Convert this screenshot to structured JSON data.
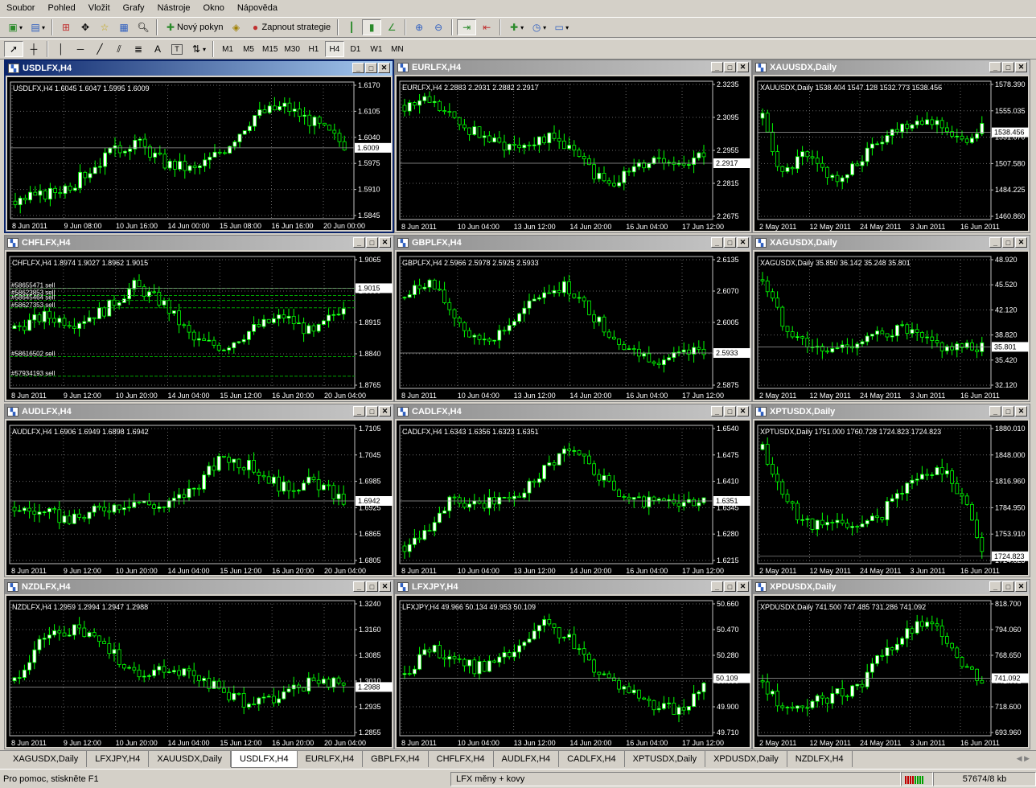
{
  "menu": [
    "Soubor",
    "Pohled",
    "Vložit",
    "Grafy",
    "Nástroje",
    "Okno",
    "Nápověda"
  ],
  "toolbar": {
    "new_order": "Nový pokyn",
    "start_strategy": "Zapnout strategie",
    "text_tool": "A",
    "label_tool": "T",
    "timeframes": [
      "M1",
      "M5",
      "M15",
      "M30",
      "H1",
      "H4",
      "D1",
      "W1",
      "MN"
    ],
    "active_timeframe": "H4"
  },
  "colors": {
    "chart_bg": "#000000",
    "bull": "#ffffff",
    "bear": "#00ff00",
    "grid": "#646464",
    "order_line": "#00a000",
    "active_title": "#0a246a",
    "inactive_title": "#8e8e8e"
  },
  "charts": [
    {
      "title": "USDLFX,H4",
      "info": "USDLFX,H4  1.6045 1.6047 1.5995 1.6009",
      "current": "1.6009",
      "prices": [
        "1.6170",
        "1.6105",
        "1.6040",
        "1.5975",
        "1.5910",
        "1.5845"
      ],
      "dates": [
        "8 Jun 2011",
        "9 Jun 08:00",
        "10 Jun 16:00",
        "14 Jun 00:00",
        "15 Jun 08:00",
        "16 Jun 16:00",
        "20 Jun 00:00"
      ],
      "trend": [
        0.1,
        0.15,
        0.25,
        0.45,
        0.58,
        0.4,
        0.35,
        0.52,
        0.78,
        0.85,
        0.72,
        0.55
      ],
      "cur_frac": 0.52,
      "active": true
    },
    {
      "title": "EURLFX,H4",
      "info": "EURLFX,H4  2.2883 2.2931 2.2882 2.2917",
      "current": "2.2917",
      "prices": [
        "2.3235",
        "2.3095",
        "2.2955",
        "2.2815",
        "2.2675"
      ],
      "dates": [
        "8 Jun 2011",
        "10 Jun 04:00",
        "13 Jun 12:00",
        "14 Jun 20:00",
        "16 Jun 04:00",
        "17 Jun 12:00"
      ],
      "trend": [
        0.85,
        0.9,
        0.75,
        0.65,
        0.55,
        0.55,
        0.6,
        0.55,
        0.35,
        0.25,
        0.35,
        0.45,
        0.4,
        0.48
      ],
      "cur_frac": 0.4,
      "active": false
    },
    {
      "title": "XAUUSDX,Daily",
      "info": "XAUUSDX,Daily  1538.404 1547.128 1532.773 1538.456",
      "current": "1538.456",
      "prices": [
        "1578.390",
        "1555.035",
        "1531.670",
        "1507.580",
        "1484.225",
        "1460.860"
      ],
      "dates": [
        "2 May 2011",
        "12 May 2011",
        "24 May 2011",
        "3 Jun 2011",
        "16 Jun 2011"
      ],
      "trend": [
        0.75,
        0.3,
        0.45,
        0.35,
        0.25,
        0.45,
        0.6,
        0.7,
        0.75,
        0.7,
        0.55,
        0.7
      ],
      "cur_frac": 0.64,
      "active": false
    },
    {
      "title": "CHFLFX,H4",
      "info": "CHFLFX,H4  1.8974 1.9027 1.8962 1.9015",
      "current": "1.9015",
      "prices": [
        "1.9065",
        "1.8990",
        "1.8915",
        "1.8840",
        "1.8765"
      ],
      "dates": [
        "8 Jun 2011",
        "9 Jun 12:00",
        "10 Jun 20:00",
        "14 Jun 04:00",
        "15 Jun 12:00",
        "16 Jun 20:00",
        "20 Jun 04:00"
      ],
      "trend": [
        0.45,
        0.55,
        0.5,
        0.6,
        0.8,
        0.65,
        0.35,
        0.3,
        0.45,
        0.55,
        0.4,
        0.65
      ],
      "cur_frac": 0.78,
      "active": false,
      "orders": [
        "#58655471 sell",
        "#58623853 sell",
        "#58645464 sell",
        "#58627353 sell",
        "#58616502 sell",
        "#57934193 sell"
      ]
    },
    {
      "title": "GBPLFX,H4",
      "info": "GBPLFX,H4  2.5966 2.5978 2.5925 2.5933",
      "current": "2.5933",
      "prices": [
        "2.6135",
        "2.6070",
        "2.6005",
        "2.5940",
        "2.5875"
      ],
      "dates": [
        "8 Jun 2011",
        "10 Jun 04:00",
        "13 Jun 12:00",
        "14 Jun 20:00",
        "16 Jun 04:00",
        "17 Jun 12:00"
      ],
      "trend": [
        0.7,
        0.85,
        0.6,
        0.35,
        0.4,
        0.55,
        0.75,
        0.8,
        0.6,
        0.4,
        0.25,
        0.2,
        0.22,
        0.28
      ],
      "cur_frac": 0.25,
      "active": false
    },
    {
      "title": "XAGUSDX,Daily",
      "info": "XAGUSDX,Daily  35.850 36.142 35.248 35.801",
      "current": "35.801",
      "prices": [
        "48.920",
        "45.520",
        "42.120",
        "38.820",
        "35.420",
        "32.120"
      ],
      "dates": [
        "2 May 2011",
        "12 May 2011",
        "24 May 2011",
        "3 Jun 2011",
        "16 Jun 2011"
      ],
      "trend": [
        0.85,
        0.5,
        0.35,
        0.25,
        0.3,
        0.35,
        0.4,
        0.45,
        0.35,
        0.3,
        0.28,
        0.3
      ],
      "cur_frac": 0.3,
      "active": false
    },
    {
      "title": "AUDLFX,H4",
      "info": "AUDLFX,H4  1.6906 1.6949 1.6898 1.6942",
      "current": "1.6942",
      "prices": [
        "1.7105",
        "1.7045",
        "1.6985",
        "1.6925",
        "1.6865",
        "1.6805"
      ],
      "dates": [
        "8 Jun 2011",
        "9 Jun 12:00",
        "10 Jun 20:00",
        "14 Jun 04:00",
        "15 Jun 12:00",
        "16 Jun 20:00",
        "20 Jun 04:00"
      ],
      "trend": [
        0.4,
        0.35,
        0.3,
        0.4,
        0.45,
        0.4,
        0.55,
        0.8,
        0.7,
        0.55,
        0.6,
        0.45
      ],
      "cur_frac": 0.45,
      "active": false
    },
    {
      "title": "CADLFX,H4",
      "info": "CADLFX,H4  1.6343 1.6356 1.6323 1.6351",
      "current": "1.6351",
      "prices": [
        "1.6540",
        "1.6475",
        "1.6410",
        "1.6345",
        "1.6280",
        "1.6215"
      ],
      "dates": [
        "8 Jun 2011",
        "10 Jun 04:00",
        "13 Jun 12:00",
        "14 Jun 20:00",
        "16 Jun 04:00",
        "17 Jun 12:00"
      ],
      "trend": [
        0.1,
        0.25,
        0.45,
        0.4,
        0.45,
        0.5,
        0.7,
        0.85,
        0.75,
        0.55,
        0.45,
        0.45,
        0.42,
        0.43
      ],
      "cur_frac": 0.45,
      "active": false
    },
    {
      "title": "XPTUSDX,Daily",
      "info": "XPTUSDX,Daily  1751.000 1760.728 1724.823 1724.823",
      "current": "1724.823",
      "prices": [
        "1880.010",
        "1848.000",
        "1816.960",
        "1784.950",
        "1753.910",
        "1724.823"
      ],
      "dates": [
        "2 May 2011",
        "12 May 2011",
        "24 May 2011",
        "3 Jun 2011",
        "16 Jun 2011"
      ],
      "trend": [
        0.85,
        0.5,
        0.3,
        0.25,
        0.28,
        0.25,
        0.35,
        0.55,
        0.65,
        0.7,
        0.5,
        0.1
      ],
      "cur_frac": 0.02,
      "active": false
    },
    {
      "title": "NZDLFX,H4",
      "info": "NZDLFX,H4  1.2959 1.2994 1.2947 1.2988",
      "current": "1.2988",
      "prices": [
        "1.3240",
        "1.3160",
        "1.3085",
        "1.3010",
        "1.2935",
        "1.2855"
      ],
      "dates": [
        "8 Jun 2011",
        "9 Jun 12:00",
        "10 Jun 20:00",
        "14 Jun 04:00",
        "15 Jun 12:00",
        "16 Jun 20:00",
        "20 Jun 04:00"
      ],
      "trend": [
        0.4,
        0.75,
        0.8,
        0.7,
        0.45,
        0.5,
        0.45,
        0.3,
        0.2,
        0.3,
        0.4,
        0.38
      ],
      "cur_frac": 0.35,
      "active": false
    },
    {
      "title": "LFXJPY,H4",
      "info": "LFXJPY,H4  49.966 50.134 49.953 50.109",
      "current": "50.109",
      "prices": [
        "50.660",
        "50.470",
        "50.280",
        "50.090",
        "49.900",
        "49.710"
      ],
      "dates": [
        "8 Jun 2011",
        "10 Jun 04:00",
        "13 Jun 12:00",
        "14 Jun 20:00",
        "16 Jun 04:00",
        "17 Jun 12:00"
      ],
      "trend": [
        0.45,
        0.65,
        0.6,
        0.5,
        0.55,
        0.65,
        0.85,
        0.75,
        0.55,
        0.4,
        0.3,
        0.2,
        0.15,
        0.35
      ],
      "cur_frac": 0.42,
      "active": false
    },
    {
      "title": "XPDUSDX,Daily",
      "info": "XPDUSDX,Daily  741.500 747.485 731.286 741.092",
      "current": "741.092",
      "prices": [
        "818.700",
        "794.060",
        "768.650",
        "741.092",
        "718.600",
        "693.960"
      ],
      "dates": [
        "2 May 2011",
        "12 May 2011",
        "24 May 2011",
        "3 Jun 2011",
        "16 Jun 2011"
      ],
      "trend": [
        0.4,
        0.15,
        0.2,
        0.25,
        0.3,
        0.4,
        0.6,
        0.75,
        0.85,
        0.8,
        0.55,
        0.4
      ],
      "cur_frac": 0.42,
      "active": false
    }
  ],
  "tabs": [
    "XAGUSDX,Daily",
    "LFXJPY,H4",
    "XAUUSDX,Daily",
    "USDLFX,H4",
    "EURLFX,H4",
    "GBPLFX,H4",
    "CHFLFX,H4",
    "AUDLFX,H4",
    "CADLFX,H4",
    "XPTUSDX,Daily",
    "XPDUSDX,Daily",
    "NZDLFX,H4"
  ],
  "active_tab": "USDLFX,H4",
  "status": {
    "help": "Pro pomoc, stiskněte F1",
    "profile": "LFX měny + kovy",
    "traffic": "57674/8 kb"
  }
}
